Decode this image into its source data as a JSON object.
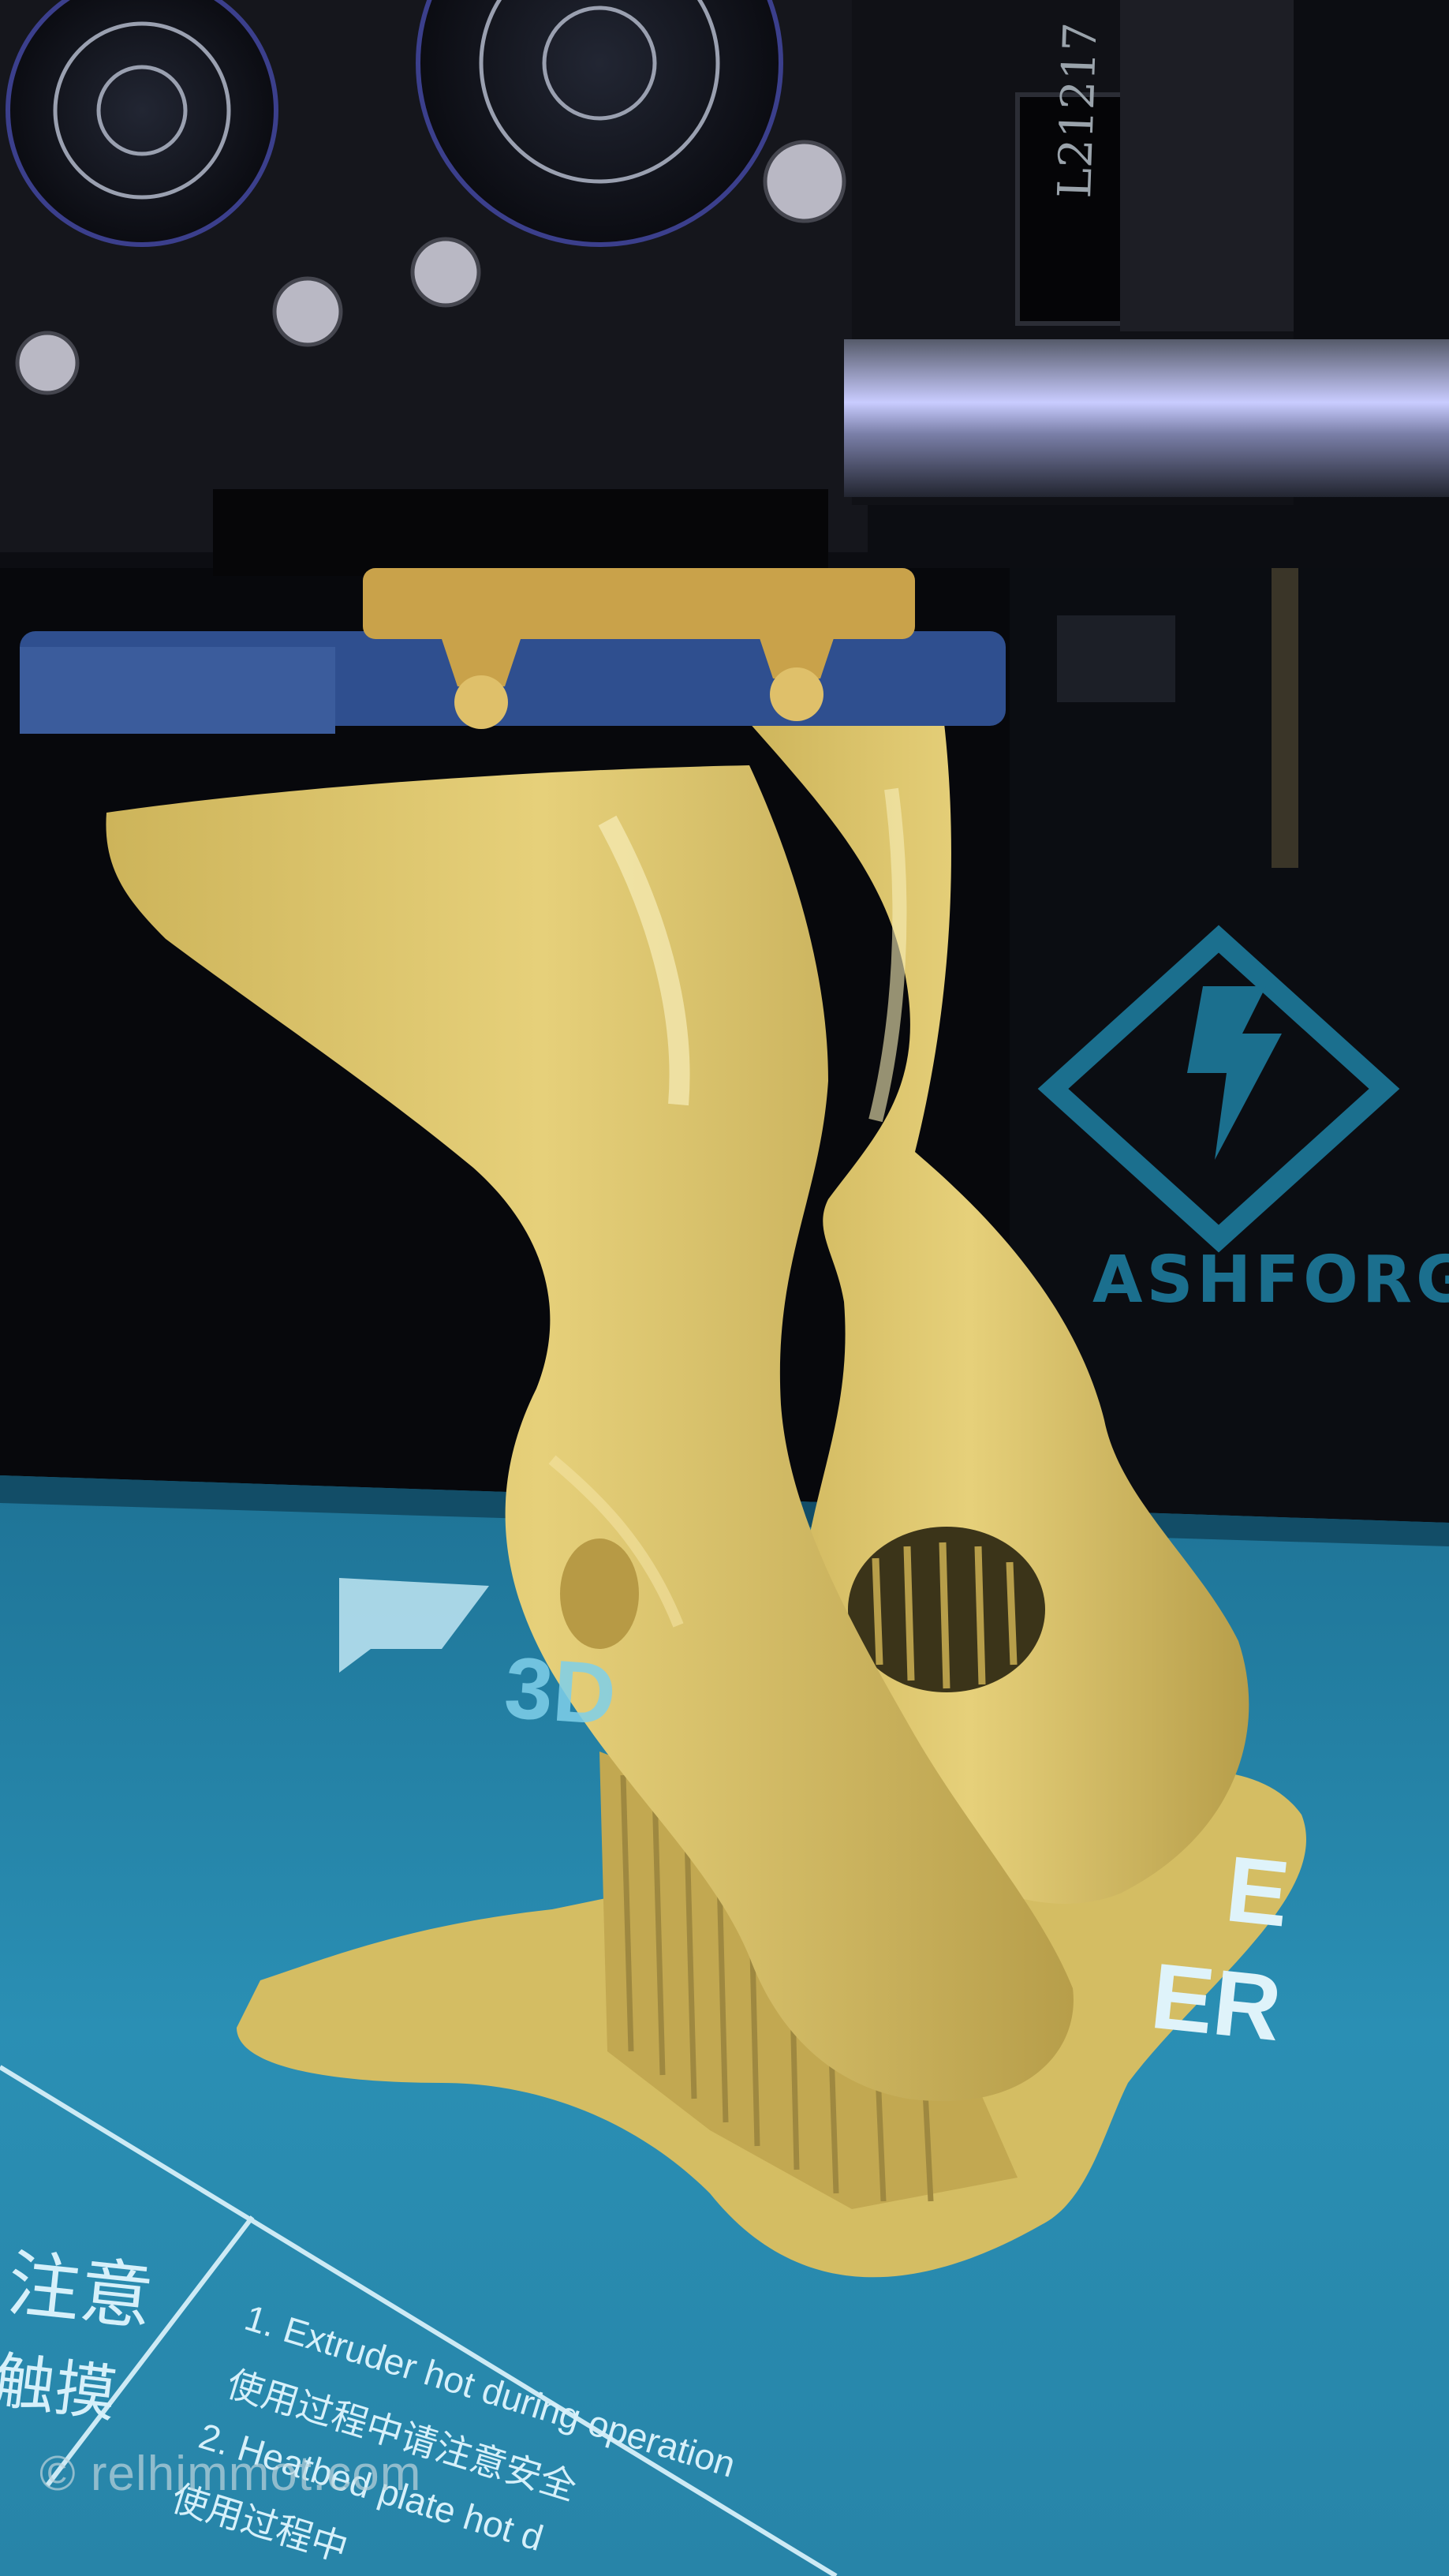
{
  "scene": {
    "caption": "3D printer printing a yellow PLA part with supports",
    "carriage_label": "L21217",
    "brand_wordmark": "ASHFORG",
    "bed_fragments": [
      "3D",
      "E",
      "ER"
    ],
    "warning": {
      "title": "注意",
      "subtitle": "触摸",
      "lines": [
        "1. Extruder hot during operation",
        "使用过程中请注意安全",
        "2. Heatbed plate hot d",
        "使用过程中"
      ]
    },
    "watermark": "© relhimmot.com",
    "colors": {
      "print_filament": "#d9c46a",
      "build_plate": "#2a8fb4",
      "brand_blue": "#1b6f8e",
      "brass_nozzle": "#c9a24a",
      "background": "#07080c"
    },
    "icons": [
      "flashforge-logo-icon",
      "cooling-fan-icon",
      "nozzle-icon"
    ]
  }
}
